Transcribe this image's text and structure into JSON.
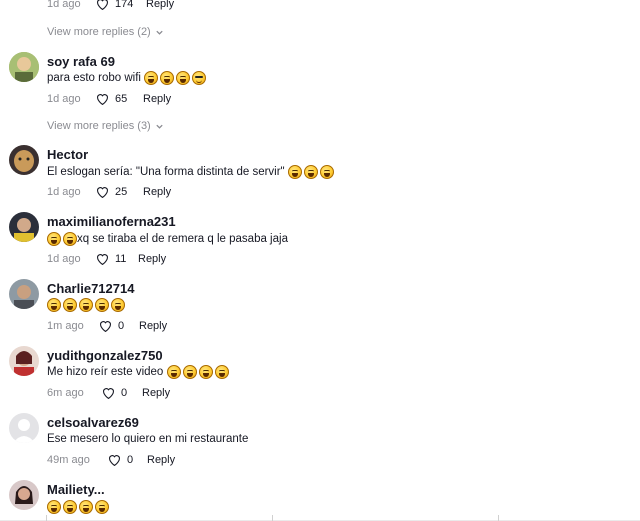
{
  "top_partial": {
    "time": "1d ago",
    "likes": "174",
    "reply_label": "Reply"
  },
  "view_more_1": "View more replies (2)",
  "view_more_2": "View more replies (3)",
  "comments": [
    {
      "username": "soy rafa 69",
      "text": "para esto robo wifi",
      "time": "1d ago",
      "likes": "65",
      "reply_label": "Reply"
    },
    {
      "username": "Hector",
      "text": "El eslogan sería: \"Una forma distinta de servir\"",
      "time": "1d ago",
      "likes": "25",
      "reply_label": "Reply"
    },
    {
      "username": "maximilianoferna231",
      "text": "xq se tiraba el de remera q le pasaba jaja",
      "time": "1d ago",
      "likes": "11",
      "reply_label": "Reply"
    },
    {
      "username": "Charlie712714",
      "text": "",
      "time": "1m ago",
      "likes": "0",
      "reply_label": "Reply"
    },
    {
      "username": "yudithgonzalez750",
      "text": "Me hizo reír este video",
      "time": "6m ago",
      "likes": "0",
      "reply_label": "Reply"
    },
    {
      "username": "celsoalvarez69",
      "text": "Ese mesero lo quiero en mi restaurante",
      "time": "49m ago",
      "likes": "0",
      "reply_label": "Reply"
    },
    {
      "username": "Mailiety...",
      "text": "",
      "time": "",
      "likes": "",
      "reply_label": ""
    }
  ],
  "icons": {
    "like": "heart-outline-icon",
    "expand": "chevron-down-icon",
    "emoji": "laughing-emoji-icon"
  },
  "colors": {
    "text": "#161823",
    "meta": "#8a8b91",
    "background": "#ffffff"
  }
}
